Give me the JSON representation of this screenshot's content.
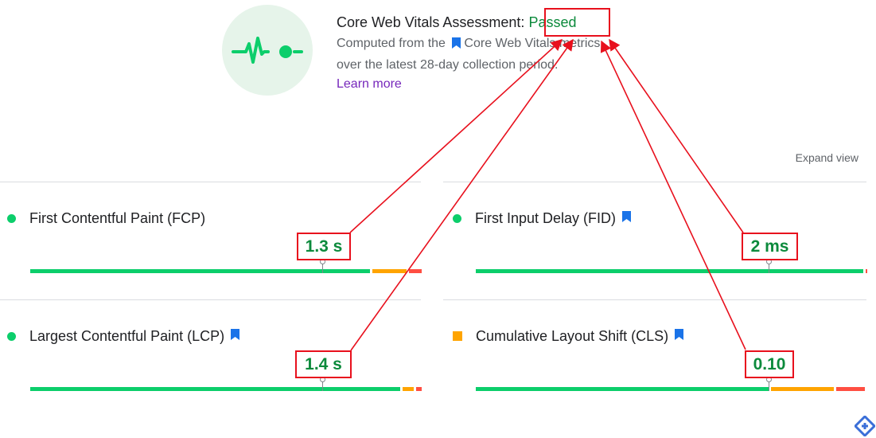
{
  "assessment": {
    "title_prefix": "Core Web Vitals Assessment: ",
    "status": "Passed",
    "desc_before": "Computed from the ",
    "desc_link": "Core Web Vitals metrics",
    "desc_after": "over the latest 28-day collection period.",
    "learn_more": "Learn more"
  },
  "expand_view": "Expand view",
  "metrics": [
    {
      "name": "First Contentful Paint (FCP)",
      "value": "1.3 s",
      "status": "good",
      "has_bookmark": false
    },
    {
      "name": "First Input Delay (FID)",
      "value": "2 ms",
      "status": "good",
      "has_bookmark": true
    },
    {
      "name": "Largest Contentful Paint (LCP)",
      "value": "1.4 s",
      "status": "good",
      "has_bookmark": true
    },
    {
      "name": "Cumulative Layout Shift (CLS)",
      "value": "0.10",
      "status": "needs-improvement",
      "has_bookmark": true
    }
  ],
  "colors": {
    "good": "#0cce6b",
    "needs_improvement": "#ffa400",
    "poor": "#ff4e42",
    "value_text": "#0c8a3c",
    "annotation": "#e8101d",
    "link": "#7627bb",
    "bookmark": "#1a73e8"
  },
  "icons": {
    "hero": "pulse-line-icon",
    "bookmark": "bookmark-icon",
    "logo": "toptal-logo-icon"
  }
}
